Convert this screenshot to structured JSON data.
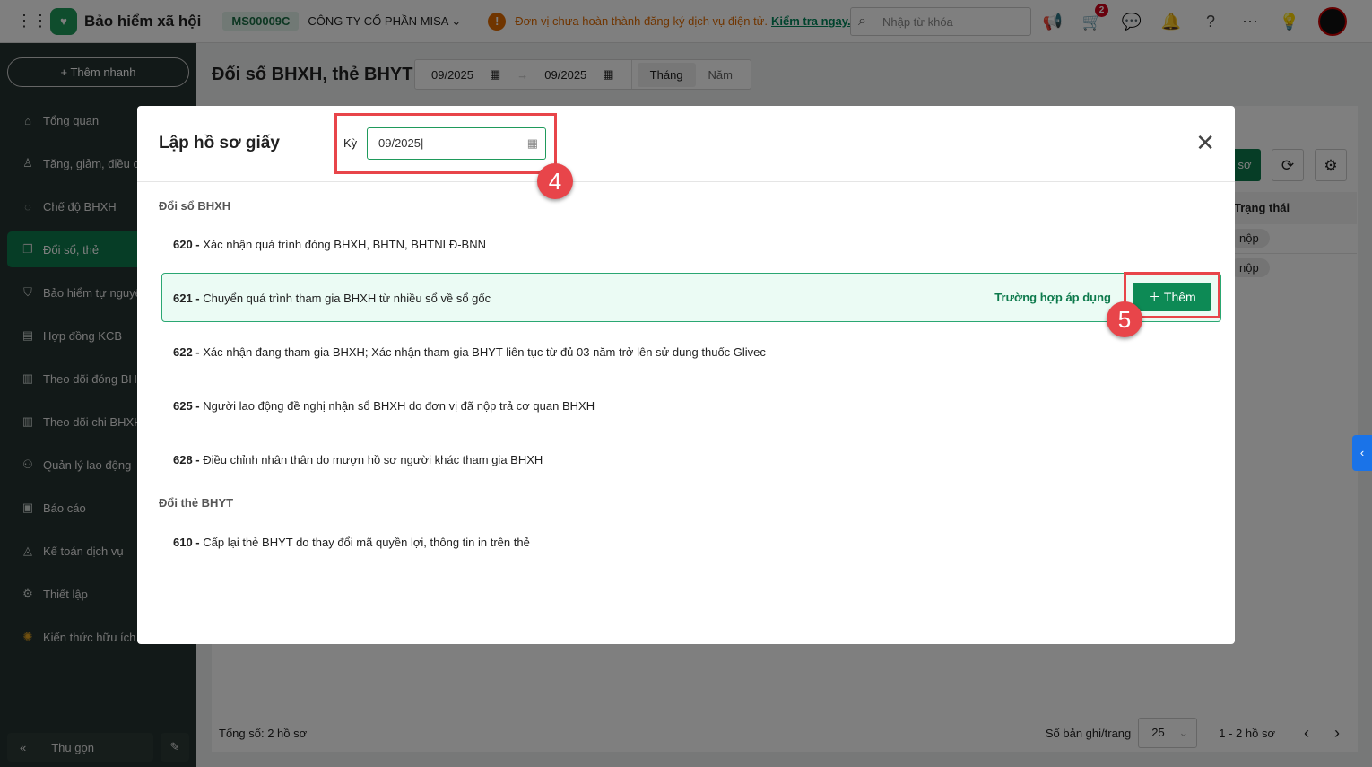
{
  "header": {
    "app_name": "Bảo hiểm xã hội",
    "company_code": "MS00009C",
    "company_name": "CÔNG TY CỔ PHẦN MISA",
    "warning": "Đơn vị chưa hoàn thành đăng ký dịch vụ điện tử.",
    "warning_link": "Kiểm tra ngay.",
    "search_placeholder": "Nhập từ khóa",
    "cart_badge": "2"
  },
  "sidebar": {
    "quick_add": "Thêm nhanh",
    "items": [
      {
        "label": "Tổng quan"
      },
      {
        "label": "Tăng, giảm, điều chỉnh"
      },
      {
        "label": "Chế độ BHXH"
      },
      {
        "label": "Đổi sổ, thẻ"
      },
      {
        "label": "Bảo hiểm tự nguyện"
      },
      {
        "label": "Hợp đồng KCB"
      },
      {
        "label": "Theo dõi đóng BHXH"
      },
      {
        "label": "Theo dõi chi BHXH"
      },
      {
        "label": "Quản lý lao động"
      },
      {
        "label": "Báo cáo"
      },
      {
        "label": "Kế toán dịch vụ"
      },
      {
        "label": "Thiết lập"
      },
      {
        "label": "Kiến thức hữu ích"
      }
    ],
    "collapse": "Thu gọn"
  },
  "page": {
    "title": "Đổi sổ BHXH, thẻ BHYT",
    "from": "09/2025",
    "to": "09/2025",
    "mode_month": "Tháng",
    "mode_year": "Năm",
    "btn_partial": "sơ",
    "col_status": "Trạng thái",
    "rows": [
      "nộp",
      "nộp"
    ],
    "total": "Tổng số: 2 hồ sơ",
    "page_size_label": "Số bản ghi/trang",
    "page_size": "25",
    "range": "1 - 2 hồ sơ"
  },
  "modal": {
    "title": "Lập hồ sơ giấy",
    "period_label": "Kỳ",
    "period_value": "09/2025",
    "section1": "Đổi sổ BHXH",
    "section2": "Đổi thẻ BHYT",
    "items": [
      {
        "code": "620 -",
        "text": "Xác nhận quá trình đóng BHXH, BHTN, BHTNLĐ-BNN"
      },
      {
        "code": "621 -",
        "text": "Chuyển quá trình tham gia BHXH từ nhiều sổ về sổ gốc"
      },
      {
        "code": "622 -",
        "text": "Xác nhận đang tham gia BHXH; Xác nhận tham gia BHYT liên tục từ đủ 03 năm trở lên sử dụng thuốc Glivec"
      },
      {
        "code": "625 -",
        "text": "Người lao động đề nghị nhận sổ BHXH do đơn vị đã nộp trả cơ quan BHXH"
      },
      {
        "code": "628 -",
        "text": "Điều chỉnh nhân thân do mượn hồ sơ người khác tham gia BHXH"
      },
      {
        "code": "610 -",
        "text": "Cấp lại thẻ BHYT do thay đổi mã quyền lợi, thông tin in trên thẻ"
      }
    ],
    "apply_link": "Trường hợp áp dụng",
    "add_button": "Thêm"
  },
  "annotations": {
    "step4": "4",
    "step5": "5"
  }
}
